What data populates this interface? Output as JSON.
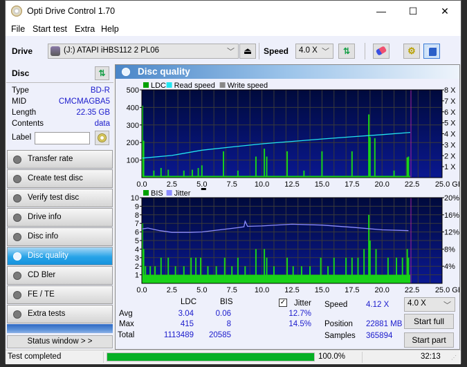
{
  "window": {
    "title": "Opti Drive Control 1.70",
    "minimize_glyph": "—",
    "maximize_glyph": "☐",
    "close_glyph": "✕"
  },
  "menu": [
    "File",
    "Start test",
    "Extra",
    "Help"
  ],
  "toolbar": {
    "drive_label": "Drive",
    "drive_value": "(J:)   ATAPI iHBS112   2 PL06",
    "speed_label": "Speed",
    "speed_value": "4.0 X",
    "icons": [
      "drive-icon",
      "eject-icon",
      "refresh-icon",
      "erase-icon",
      "options-icon",
      "save-icon"
    ]
  },
  "disc": {
    "header": "Disc",
    "rows": [
      {
        "key": "Type",
        "value": "BD-R"
      },
      {
        "key": "MID",
        "value": "CMCMAGBA5"
      },
      {
        "key": "Length",
        "value": "22.35 GB"
      },
      {
        "key": "Contents",
        "value": "data"
      }
    ],
    "label_key": "Label",
    "label_value": ""
  },
  "nav": [
    {
      "label": "Transfer rate",
      "active": false
    },
    {
      "label": "Create test disc",
      "active": false
    },
    {
      "label": "Verify test disc",
      "active": false
    },
    {
      "label": "Drive info",
      "active": false
    },
    {
      "label": "Disc info",
      "active": false
    },
    {
      "label": "Disc quality",
      "active": true
    },
    {
      "label": "CD Bler",
      "active": false
    },
    {
      "label": "FE / TE",
      "active": false
    },
    {
      "label": "Extra tests",
      "active": false
    }
  ],
  "status_window_label": "Status window > >",
  "panel": {
    "title": "Disc quality"
  },
  "stats": {
    "col_ldc": "LDC",
    "col_bis": "BIS",
    "col_jitter": "Jitter",
    "jitter_checked": true,
    "rows": [
      {
        "label": "Avg",
        "ldc": "3.04",
        "bis": "0.06",
        "jitter": "12.7%"
      },
      {
        "label": "Max",
        "ldc": "415",
        "bis": "8",
        "jitter": "14.5%"
      },
      {
        "label": "Total",
        "ldc": "1113489",
        "bis": "20585",
        "jitter": ""
      }
    ],
    "speed_label": "Speed",
    "speed_value": "4.12 X",
    "position_label": "Position",
    "position_value": "22881 MB",
    "samples_label": "Samples",
    "samples_value": "365894",
    "speed_select": "4.0 X",
    "start_full": "Start full",
    "start_part": "Start part"
  },
  "statusbar": {
    "text": "Test completed",
    "progress_percent": 100,
    "progress_text": "100.0%",
    "time": "32:13"
  },
  "colors": {
    "ldc": "#00a000",
    "bar_green": "#19d219",
    "read_speed": "#22e4f0",
    "write_speed": "#888888",
    "jitter": "#8c8cff",
    "plot_bg_top": "#000a3c",
    "plot_bg_bottom": "#0a1890",
    "marker": "#a020a0"
  },
  "chart_data": [
    {
      "type": "bar",
      "title": "LDC / Read speed",
      "legend": [
        "LDC",
        "Read speed",
        "Write speed"
      ],
      "legend_position": "top-left",
      "xlabel": "GB",
      "x_range": [
        0,
        25
      ],
      "x_ticks": [
        "0.0",
        "2.5",
        "5.0",
        "7.5",
        "10.0",
        "12.5",
        "15.0",
        "17.5",
        "20.0",
        "22.5",
        "25.0 GB"
      ],
      "y_left_range": [
        0,
        500
      ],
      "y_left_ticks": [
        "100",
        "200",
        "300",
        "400",
        "500"
      ],
      "y_right_range": [
        0,
        8
      ],
      "y_right_ticks": [
        "1 X",
        "2 X",
        "3 X",
        "4 X",
        "5 X",
        "6 X",
        "7 X",
        "8 X"
      ],
      "grid": true,
      "end_marker_gb": 22.35,
      "ldc_baseline": 10,
      "ldc_spikes": [
        {
          "x": 0.05,
          "y": 410
        },
        {
          "x": 0.15,
          "y": 210
        },
        {
          "x": 1.0,
          "y": 40
        },
        {
          "x": 1.6,
          "y": 55
        },
        {
          "x": 2.2,
          "y": 45
        },
        {
          "x": 3.5,
          "y": 40
        },
        {
          "x": 4.2,
          "y": 45
        },
        {
          "x": 4.7,
          "y": 55
        },
        {
          "x": 5.0,
          "y": 70
        },
        {
          "x": 6.8,
          "y": 150
        },
        {
          "x": 8.0,
          "y": 40
        },
        {
          "x": 9.5,
          "y": 120
        },
        {
          "x": 10.2,
          "y": 165
        },
        {
          "x": 10.4,
          "y": 120
        },
        {
          "x": 12.1,
          "y": 150
        },
        {
          "x": 13.5,
          "y": 40
        },
        {
          "x": 15.0,
          "y": 150
        },
        {
          "x": 17.5,
          "y": 150
        },
        {
          "x": 18.9,
          "y": 360
        },
        {
          "x": 19.0,
          "y": 230
        },
        {
          "x": 19.4,
          "y": 225
        },
        {
          "x": 21.0,
          "y": 40
        },
        {
          "x": 22.1,
          "y": 115
        },
        {
          "x": 22.2,
          "y": 120
        }
      ],
      "read_speed": [
        {
          "x": 0.0,
          "y": 1.8
        },
        {
          "x": 0.1,
          "y": 1.78
        },
        {
          "x": 2.5,
          "y": 2.02
        },
        {
          "x": 5.0,
          "y": 2.5
        },
        {
          "x": 7.5,
          "y": 2.8
        },
        {
          "x": 10.0,
          "y": 3.08
        },
        {
          "x": 12.5,
          "y": 3.3
        },
        {
          "x": 15.0,
          "y": 3.52
        },
        {
          "x": 17.5,
          "y": 3.72
        },
        {
          "x": 20.0,
          "y": 3.92
        },
        {
          "x": 22.35,
          "y": 4.12
        }
      ]
    },
    {
      "type": "bar",
      "title": "BIS / Jitter",
      "legend": [
        "BIS",
        "Jitter"
      ],
      "legend_position": "top-left",
      "xlabel": "GB",
      "x_range": [
        0,
        25
      ],
      "x_ticks": [
        "0.0",
        "2.5",
        "5.0",
        "7.5",
        "10.0",
        "12.5",
        "15.0",
        "17.5",
        "20.0",
        "22.5",
        "25.0 GB"
      ],
      "y_left_range": [
        0,
        10
      ],
      "y_left_ticks": [
        "1",
        "2",
        "3",
        "4",
        "5",
        "6",
        "7",
        "8",
        "9",
        "10"
      ],
      "y_right_range": [
        0,
        20
      ],
      "y_right_ticks": [
        "4%",
        "8%",
        "12%",
        "16%",
        "20%"
      ],
      "grid": true,
      "end_marker_gb": 22.35,
      "bis_baseline": 1,
      "bis_spikes": [
        {
          "x": 0.05,
          "y": 7
        },
        {
          "x": 0.15,
          "y": 4
        },
        {
          "x": 0.3,
          "y": 2
        },
        {
          "x": 0.7,
          "y": 2
        },
        {
          "x": 1.1,
          "y": 2
        },
        {
          "x": 1.6,
          "y": 3
        },
        {
          "x": 2.2,
          "y": 3
        },
        {
          "x": 2.8,
          "y": 2
        },
        {
          "x": 3.5,
          "y": 2
        },
        {
          "x": 4.1,
          "y": 3
        },
        {
          "x": 4.5,
          "y": 3
        },
        {
          "x": 4.9,
          "y": 3
        },
        {
          "x": 5.5,
          "y": 2
        },
        {
          "x": 6.2,
          "y": 2
        },
        {
          "x": 6.9,
          "y": 3
        },
        {
          "x": 7.5,
          "y": 2
        },
        {
          "x": 8.0,
          "y": 3
        },
        {
          "x": 8.6,
          "y": 2
        },
        {
          "x": 9.5,
          "y": 4
        },
        {
          "x": 10.2,
          "y": 4
        },
        {
          "x": 10.4,
          "y": 3
        },
        {
          "x": 11.0,
          "y": 2
        },
        {
          "x": 12.1,
          "y": 3
        },
        {
          "x": 12.6,
          "y": 2
        },
        {
          "x": 13.3,
          "y": 2
        },
        {
          "x": 14.0,
          "y": 2
        },
        {
          "x": 14.9,
          "y": 3
        },
        {
          "x": 15.5,
          "y": 2
        },
        {
          "x": 16.0,
          "y": 3
        },
        {
          "x": 17.0,
          "y": 3
        },
        {
          "x": 17.5,
          "y": 3
        },
        {
          "x": 18.0,
          "y": 3
        },
        {
          "x": 18.5,
          "y": 4
        },
        {
          "x": 18.9,
          "y": 8
        },
        {
          "x": 19.0,
          "y": 5
        },
        {
          "x": 19.5,
          "y": 4
        },
        {
          "x": 20.5,
          "y": 3
        },
        {
          "x": 21.2,
          "y": 3
        },
        {
          "x": 21.7,
          "y": 3
        },
        {
          "x": 22.1,
          "y": 4
        },
        {
          "x": 22.2,
          "y": 3
        }
      ],
      "jitter_percent": [
        {
          "x": 0.0,
          "y": 12.7
        },
        {
          "x": 0.5,
          "y": 12.9
        },
        {
          "x": 1.5,
          "y": 12.3
        },
        {
          "x": 2.5,
          "y": 11.9
        },
        {
          "x": 4.0,
          "y": 11.9
        },
        {
          "x": 5.0,
          "y": 12.0
        },
        {
          "x": 6.5,
          "y": 12.5
        },
        {
          "x": 8.0,
          "y": 13.0
        },
        {
          "x": 8.5,
          "y": 13.2
        },
        {
          "x": 8.6,
          "y": 14.5
        },
        {
          "x": 8.8,
          "y": 13.3
        },
        {
          "x": 10.0,
          "y": 13.4
        },
        {
          "x": 12.5,
          "y": 13.8
        },
        {
          "x": 15.0,
          "y": 13.6
        },
        {
          "x": 17.5,
          "y": 13.1
        },
        {
          "x": 20.0,
          "y": 12.5
        },
        {
          "x": 22.2,
          "y": 12.3
        }
      ]
    }
  ]
}
